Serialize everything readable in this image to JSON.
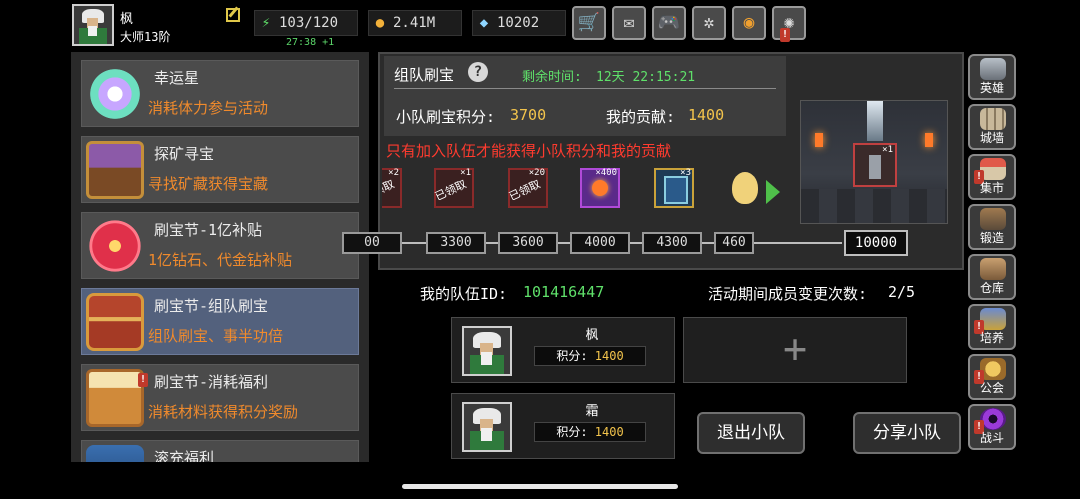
{
  "player": {
    "name": "枫",
    "rank": "大师13阶"
  },
  "resources": {
    "energy": "103/120",
    "energy_timer": "27:38 +1",
    "gold": "2.41M",
    "gems": "10202"
  },
  "top_icons": [
    "shop-icon",
    "mail-icon",
    "gamepad-icon",
    "gear-icon",
    "camera-aperture-icon",
    "broken-glass-icon"
  ],
  "events": [
    {
      "title": "幸运星",
      "desc": "消耗体力参与活动",
      "icon": "lucky-star-icon"
    },
    {
      "title": "探矿寻宝",
      "desc": "寻找矿藏获得宝藏",
      "icon": "mining-chest-icon"
    },
    {
      "title": "刷宝节-1亿补贴",
      "desc": "1亿钻石、代金钻补贴",
      "icon": "red-flower-icon"
    },
    {
      "title": "刷宝节-组队刷宝",
      "desc": "组队刷宝、事半功倍",
      "icon": "treasure-chest-icon",
      "selected": true
    },
    {
      "title": "刷宝节-消耗福利",
      "desc": "消耗材料获得积分奖励",
      "icon": "open-chest-icon"
    },
    {
      "title": "滚充福利",
      "desc": "",
      "icon": "blue-item-icon"
    }
  ],
  "team_treasure": {
    "title": "组队刷宝",
    "remaining_label": "剩余时间:",
    "remaining_value": "12天 22:15:21",
    "team_score_label": "小队刷宝积分:",
    "team_score": "3700",
    "my_contrib_label": "我的贡献:",
    "my_contrib": "1400",
    "warning": "只有加入队伍才能获得小队积分和我的贡献"
  },
  "rewards": [
    {
      "mult": "×2",
      "stamp": "已领取"
    },
    {
      "mult": "×1",
      "stamp": "已领取"
    },
    {
      "mult": "×20",
      "stamp": "已领取"
    },
    {
      "mult": "×400",
      "stamp": ""
    },
    {
      "mult": "×3",
      "stamp": ""
    },
    {
      "mult": "",
      "stamp": ""
    }
  ],
  "milestones": [
    "00",
    "3300",
    "3600",
    "4000",
    "4300",
    "460"
  ],
  "milestone_final": "10000",
  "scene_reward": {
    "mult": "×1"
  },
  "team": {
    "id_label": "我的队伍ID:",
    "id_value": "101416447",
    "changes_label": "活动期间成员变更次数:",
    "changes_value": "2/5",
    "members": [
      {
        "name": "枫",
        "score_label": "积分:",
        "score": "1400"
      },
      {
        "name": "霜",
        "score_label": "积分:",
        "score": "1400"
      }
    ],
    "add_symbol": "+"
  },
  "buttons": {
    "leave": "退出小队",
    "share": "分享小队"
  },
  "sidebar": [
    {
      "label": "英雄",
      "icon": "helmet-icon",
      "alert": false
    },
    {
      "label": "城墙",
      "icon": "castle-wall-icon",
      "alert": false
    },
    {
      "label": "集市",
      "icon": "market-stall-icon",
      "alert": true
    },
    {
      "label": "锻造",
      "icon": "anvil-icon",
      "alert": false
    },
    {
      "label": "仓库",
      "icon": "warehouse-icon",
      "alert": false
    },
    {
      "label": "培养",
      "icon": "trophy-icon",
      "alert": true
    },
    {
      "label": "公会",
      "icon": "guild-banner-icon",
      "alert": true
    },
    {
      "label": "战斗",
      "icon": "vortex-portal-icon",
      "alert": true
    }
  ],
  "colors": {
    "accent_green": "#5fe06a",
    "accent_gold": "#f3c44c",
    "warning_red": "#ff3b2f",
    "desc_orange": "#f08a2c"
  }
}
